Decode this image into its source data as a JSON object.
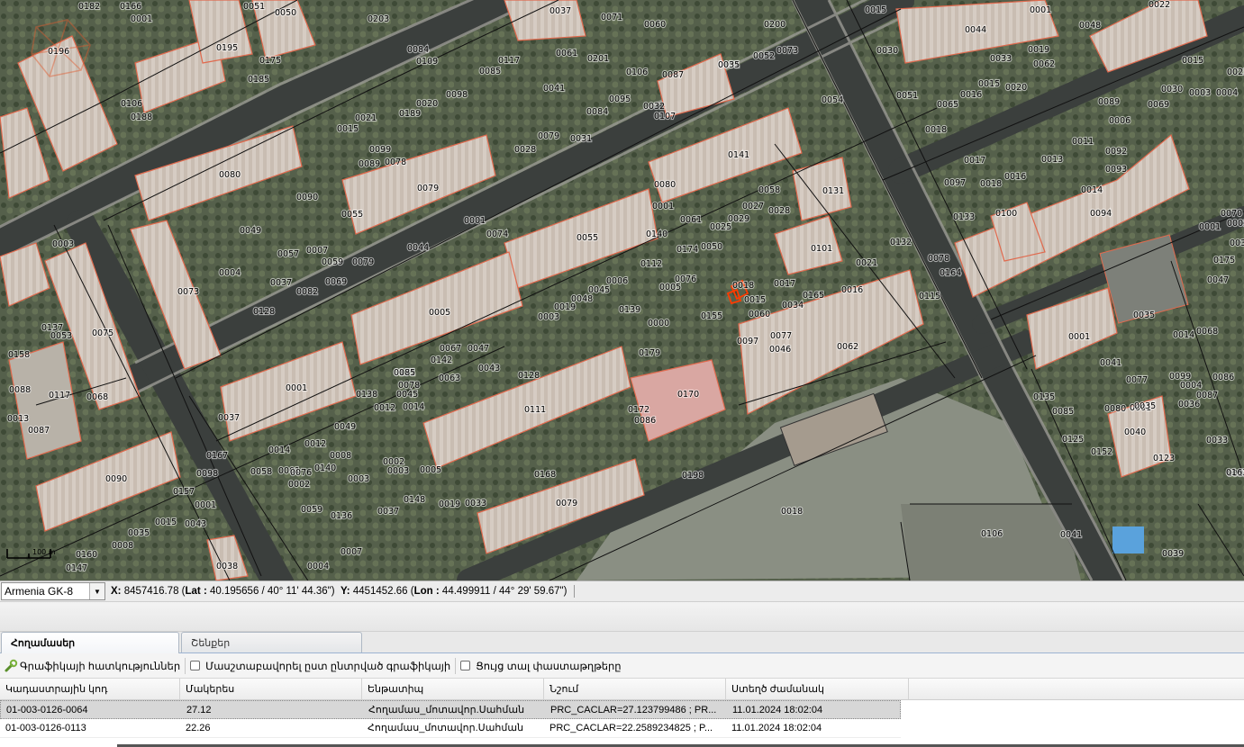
{
  "map": {
    "parcel_labels": [
      "0182",
      "0166",
      "0001",
      "0051",
      "0050",
      "0203",
      "0037",
      "0071",
      "0060",
      "0200",
      "0015",
      "0022",
      "0196",
      "0195",
      "0175",
      "0185",
      "0084",
      "0109",
      "0117",
      "0085",
      "0061",
      "0201",
      "0106",
      "0087",
      "0051",
      "0052",
      "0073",
      "0054",
      "0044",
      "0048",
      "0030",
      "0019",
      "0033",
      "0062",
      "0015",
      "0025",
      "0106",
      "0188",
      "0189",
      "0020",
      "0021",
      "0098",
      "0041",
      "0095",
      "0084",
      "0032",
      "0107",
      "0035",
      "0051",
      "0065",
      "0016",
      "0015",
      "0020",
      "0089",
      "0030",
      "0003",
      "0069",
      "0004",
      "0001",
      "0015",
      "0099",
      "0078",
      "0089",
      "0028",
      "0079",
      "0031",
      "0141",
      "0018",
      "0006",
      "0011",
      "0092",
      "0093",
      "0080",
      "0090",
      "0079",
      "0017",
      "0097",
      "0018",
      "0016",
      "0013",
      "0014",
      "0080",
      "0058",
      "0131",
      "0133",
      "0100",
      "0094",
      "0070",
      "0002",
      "0001",
      "0074",
      "0001",
      "0061",
      "0025",
      "0029",
      "0027",
      "0028",
      "0055",
      "0140",
      "0174",
      "0050",
      "0101",
      "0132",
      "0078",
      "0164",
      "0001",
      "0038",
      "0003",
      "0049",
      "0055",
      "0057",
      "0007",
      "0044",
      "0059",
      "0079",
      "0112",
      "0076",
      "0021",
      "0175",
      "0073",
      "0004",
      "0037",
      "0082",
      "0069",
      "0005",
      "0006",
      "0045",
      "0048",
      "0019",
      "0018",
      "0017",
      "0016",
      "0115",
      "0047",
      "0035",
      "0128",
      "0005",
      "0003",
      "0139",
      "0015",
      "0165",
      "0034",
      "0155",
      "0060",
      "0000",
      "0097",
      "0077",
      "0046",
      "0062",
      "0001",
      "0137",
      "0075",
      "0053",
      "0067",
      "0047",
      "0179",
      "0158",
      "0142",
      "0043",
      "0171",
      "0014",
      "0068",
      "0041",
      "0077",
      "0099",
      "0004",
      "0086",
      "0087",
      "0085",
      "0078",
      "0063",
      "0128",
      "0170",
      "0001",
      "0045",
      "0138",
      "0117",
      "0068",
      "0088",
      "0013",
      "0087",
      "0037",
      "0012",
      "0014",
      "0111",
      "0172",
      "0086",
      "0135",
      "0085",
      "0080",
      "0001",
      "0035",
      "0040",
      "0036",
      "0033",
      "0049",
      "0012",
      "0014",
      "0008",
      "0125",
      "0152",
      "0167",
      "0090",
      "0058",
      "0001",
      "0140",
      "0002",
      "0003",
      "0005",
      "0123",
      "0168",
      "0032",
      "0076",
      "0098",
      "0002",
      "0003",
      "0198",
      "0157",
      "0148",
      "0001",
      "0019",
      "0033",
      "0079",
      "0163",
      "0059",
      "0136",
      "0015",
      "0043",
      "0037",
      "0018",
      "0106",
      "0041",
      "0035",
      "0008",
      "0007",
      "0004",
      "0160",
      "0147",
      "0038",
      "0039",
      "0015",
      "0014",
      "0143",
      "0106"
    ],
    "scale_label": "100 m"
  },
  "coord_bar": {
    "crs_value": "Armenia GK-8",
    "x_label": "X:",
    "x_value": "8457416.78",
    "lat_label": "Lat :",
    "lat_value": "40.195656 / 40° 11' 44.36\"",
    "y_label": "Y:",
    "y_value": "4451452.66",
    "lon_label": "Lon :",
    "lon_value": "44.499911 / 44° 29' 59.67\""
  },
  "tabs": [
    {
      "label": "Հողամասեր",
      "active": true
    },
    {
      "label": "Շենքեր",
      "active": false
    }
  ],
  "toolbar": {
    "graphics_properties_label": "Գրաֆիկայի հատկություններ",
    "scale_by_selected_label": "Մասշտաբավորել ըստ ընտրված գրաֆիկայի",
    "show_documents_label": "Ցույց տալ փաստաթղթերը"
  },
  "grid": {
    "columns": [
      "Կադաստրային կոդ",
      "Մակերես",
      "Ենթատիպ",
      "Նշում",
      "Ստեղծ ժամանակ"
    ],
    "rows": [
      {
        "code": "01-003-0126-0064",
        "area": "27.12",
        "subtype": "Հողամաս_մոտավոր.Սահման",
        "note": "PRC_CACLAR=27.123799486 ; PR...",
        "created": "11.01.2024 18:02:04",
        "selected": true
      },
      {
        "code": "01-003-0126-0113",
        "area": "22.26",
        "subtype": "Հողամաս_մոտավոր.Սահման",
        "note": "PRC_CACLAR=22.2589234825 ; P...",
        "created": "11.01.2024 18:02:04",
        "selected": false
      }
    ]
  },
  "colors": {
    "parcel_outline": "#e06a4e",
    "boundary": "#111111",
    "selection": "#ff3b00",
    "tab_border": "#9db4d2"
  }
}
